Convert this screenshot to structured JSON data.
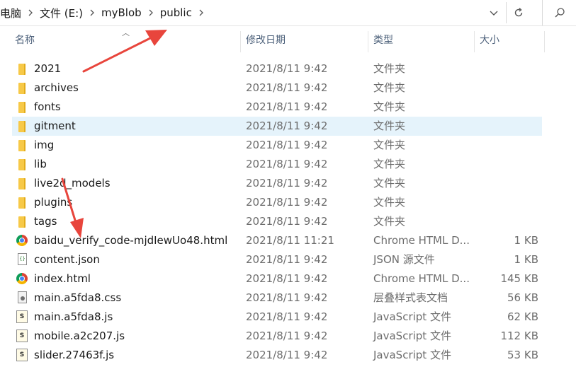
{
  "breadcrumb": {
    "items": [
      "电脑",
      "文件 (E:)",
      "myBlob",
      "public"
    ]
  },
  "icons": {
    "separator": "chevron-right-icon",
    "dropdown": "chevron-down-icon",
    "refresh": "refresh-icon",
    "search": "search-icon"
  },
  "columns": {
    "name": "名称",
    "date": "修改日期",
    "type": "类型",
    "size": "大小"
  },
  "files": [
    {
      "name": "2021",
      "date": "2021/8/11 9:42",
      "type": "文件夹",
      "size": "",
      "icon": "folder-icon"
    },
    {
      "name": "archives",
      "date": "2021/8/11 9:42",
      "type": "文件夹",
      "size": "",
      "icon": "folder-icon"
    },
    {
      "name": "fonts",
      "date": "2021/8/11 9:42",
      "type": "文件夹",
      "size": "",
      "icon": "folder-icon"
    },
    {
      "name": "gitment",
      "date": "2021/8/11 9:42",
      "type": "文件夹",
      "size": "",
      "icon": "folder-icon",
      "selected": true
    },
    {
      "name": "img",
      "date": "2021/8/11 9:42",
      "type": "文件夹",
      "size": "",
      "icon": "folder-icon"
    },
    {
      "name": "lib",
      "date": "2021/8/11 9:42",
      "type": "文件夹",
      "size": "",
      "icon": "folder-icon"
    },
    {
      "name": "live2d_models",
      "date": "2021/8/11 9:42",
      "type": "文件夹",
      "size": "",
      "icon": "folder-icon"
    },
    {
      "name": "plugins",
      "date": "2021/8/11 9:42",
      "type": "文件夹",
      "size": "",
      "icon": "folder-icon"
    },
    {
      "name": "tags",
      "date": "2021/8/11 9:42",
      "type": "文件夹",
      "size": "",
      "icon": "folder-icon"
    },
    {
      "name": "baidu_verify_code-mjdIewUo48.html",
      "date": "2021/8/11 11:21",
      "type": "Chrome HTML D...",
      "size": "1 KB",
      "icon": "chrome-icon"
    },
    {
      "name": "content.json",
      "date": "2021/8/11 9:42",
      "type": "JSON 源文件",
      "size": "1 KB",
      "icon": "json-file-icon"
    },
    {
      "name": "index.html",
      "date": "2021/8/11 9:42",
      "type": "Chrome HTML D...",
      "size": "145 KB",
      "icon": "chrome-icon"
    },
    {
      "name": "main.a5fda8.css",
      "date": "2021/8/11 9:42",
      "type": "层叠样式表文档",
      "size": "56 KB",
      "icon": "css-file-icon"
    },
    {
      "name": "main.a5fda8.js",
      "date": "2021/8/11 9:42",
      "type": "JavaScript 文件",
      "size": "62 KB",
      "icon": "js-file-icon"
    },
    {
      "name": "mobile.a2c207.js",
      "date": "2021/8/11 9:42",
      "type": "JavaScript 文件",
      "size": "112 KB",
      "icon": "js-file-icon"
    },
    {
      "name": "slider.27463f.js",
      "date": "2021/8/11 9:42",
      "type": "JavaScript 文件",
      "size": "53 KB",
      "icon": "js-file-icon"
    }
  ],
  "colors": {
    "selection": "#e5f3fb",
    "folder": "#f7c948",
    "annotation_arrow": "#e8453c",
    "header_text": "#4c607a"
  }
}
